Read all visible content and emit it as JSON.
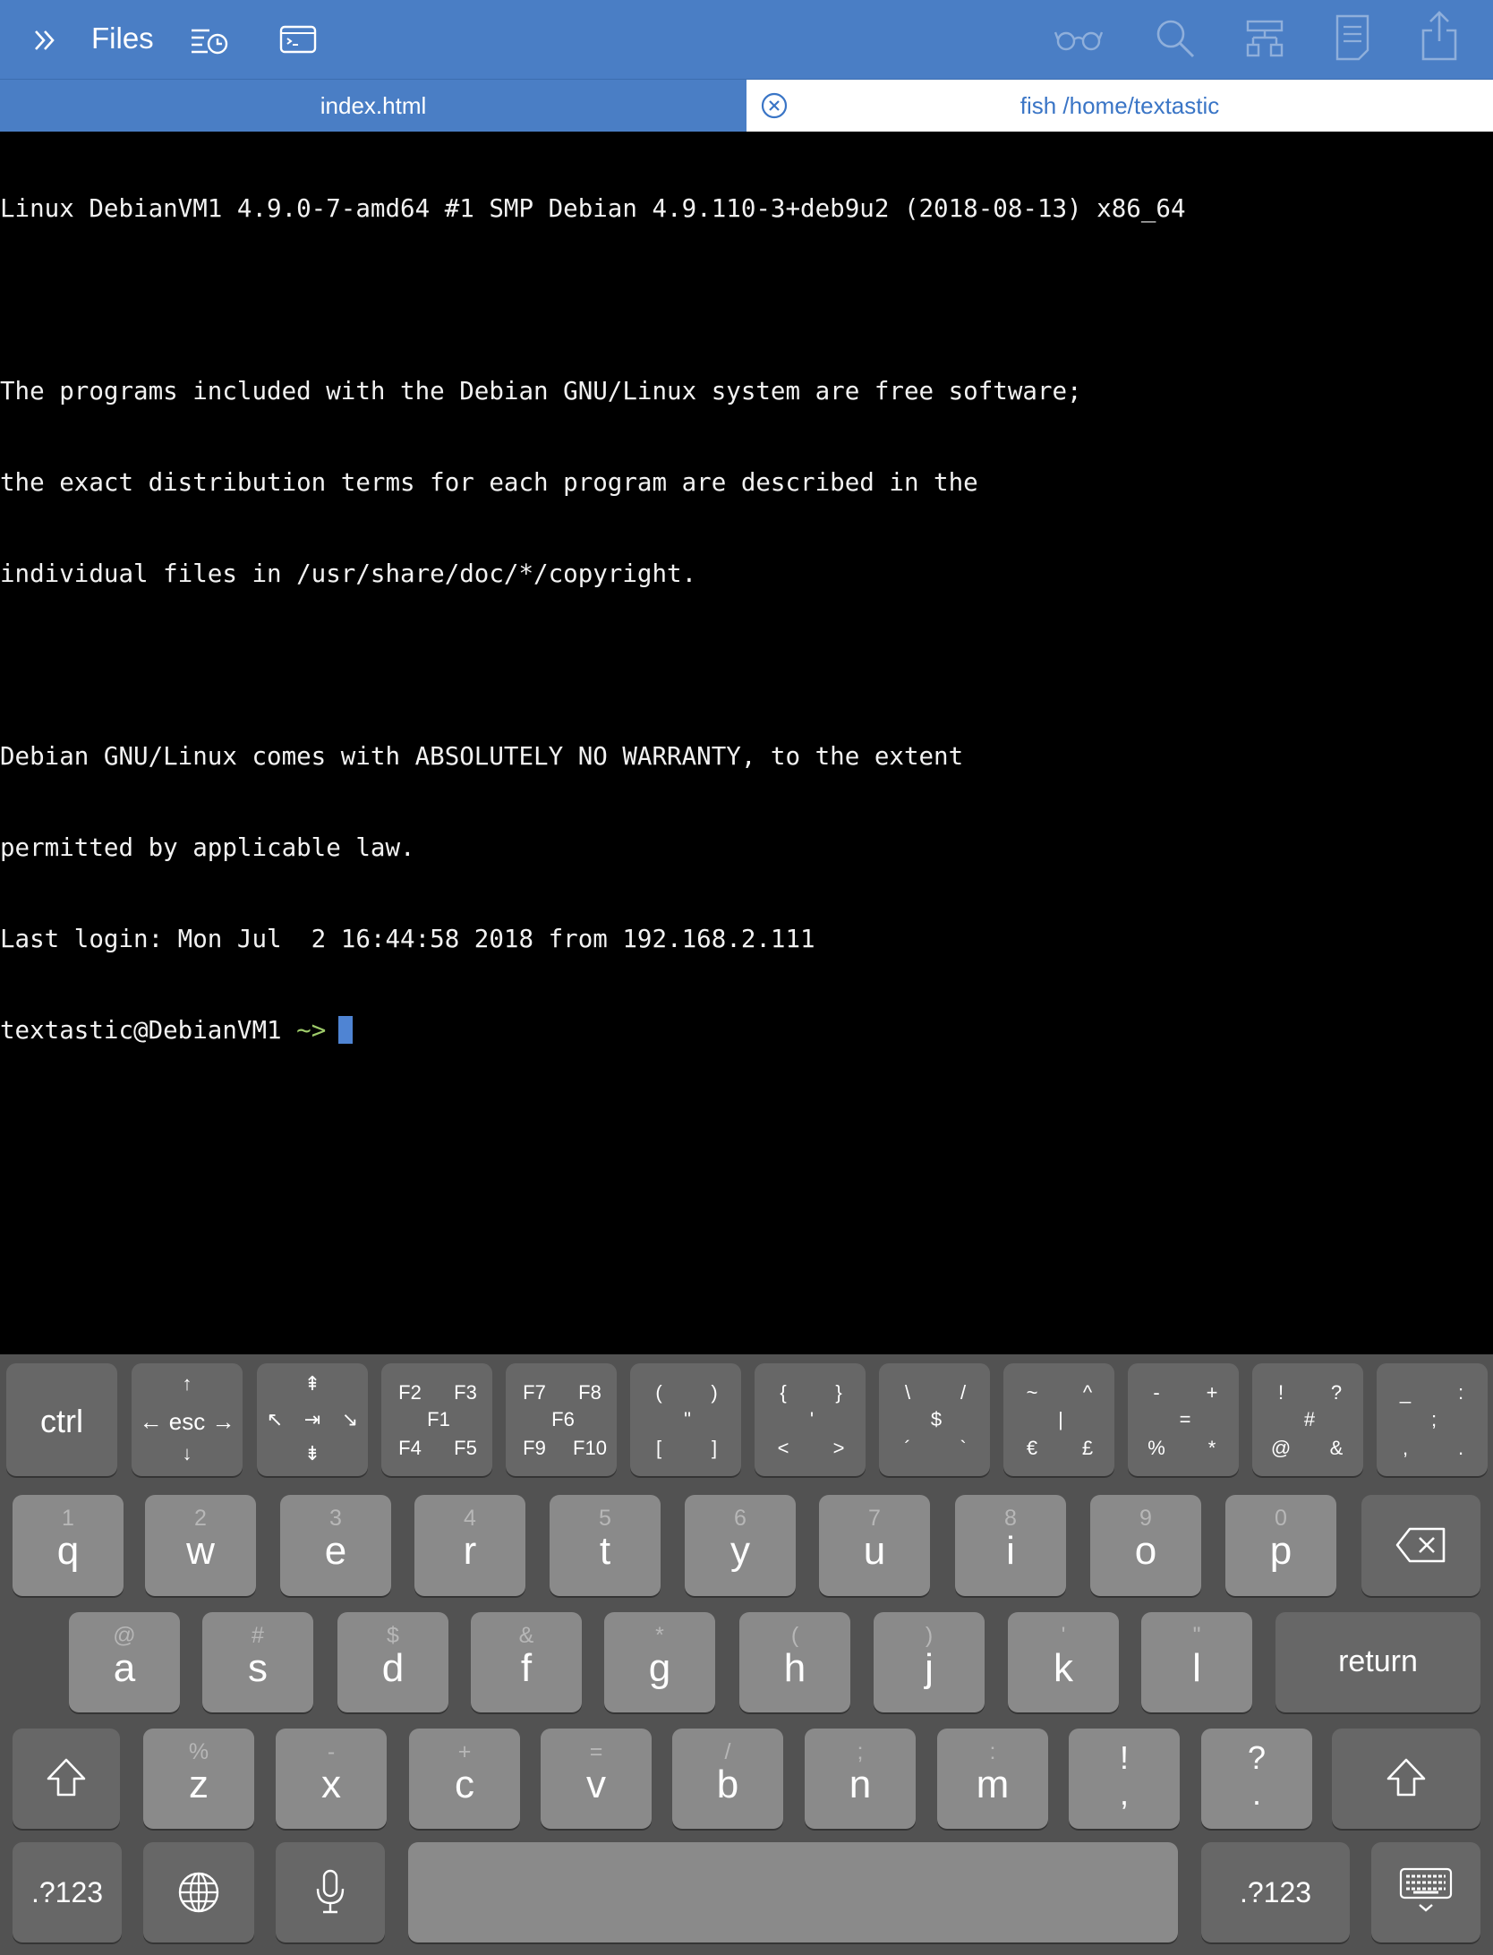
{
  "toolbar": {
    "files_label": "Files",
    "background": "#4a7ec5"
  },
  "tabs": [
    {
      "label": "index.html",
      "active": false
    },
    {
      "label": "fish  /home/textastic",
      "active": true
    }
  ],
  "terminal": {
    "lines": [
      "Linux DebianVM1 4.9.0-7-amd64 #1 SMP Debian 4.9.110-3+deb9u2 (2018-08-13) x86_64",
      "",
      "The programs included with the Debian GNU/Linux system are free software;",
      "the exact distribution terms for each program are described in the",
      "individual files in /usr/share/doc/*/copyright.",
      "",
      "Debian GNU/Linux comes with ABSOLUTELY NO WARRANTY, to the extent",
      "permitted by applicable law.",
      "Last login: Mon Jul  2 16:44:58 2018 from 192.168.2.111"
    ],
    "prompt_user": "textastic@DebianVM1",
    "prompt_symbol": "~>"
  },
  "keyboard": {
    "extra_row": {
      "ctrl": "ctrl",
      "esc": {
        "up": "↑",
        "label": "← esc →",
        "down": "↓"
      },
      "tab_key": {
        "top": "⇞",
        "left": "↖",
        "mid": "⇥",
        "right": "↘",
        "bottom": "⇟"
      },
      "fkeys_1": [
        "F2",
        "F3",
        "F1",
        "F4",
        "F5"
      ],
      "fkeys_2": [
        "F7",
        "F8",
        "F6",
        "F9",
        "F10"
      ],
      "parens": [
        "(",
        ")",
        "\"",
        "[",
        "]"
      ],
      "braces": [
        "{",
        "}",
        "'",
        "<",
        ">"
      ],
      "slashes": [
        "\\",
        "/",
        "$",
        "´",
        "`"
      ],
      "currency": [
        "~",
        "^",
        "|",
        "€",
        "£"
      ],
      "math": [
        "-",
        "+",
        "=",
        "%",
        "*"
      ],
      "punct": [
        "!",
        "?",
        "#",
        "@",
        "&"
      ],
      "misc": [
        "_",
        ":",
        ";",
        ",",
        "."
      ]
    },
    "row1": [
      {
        "key": "q",
        "alt": "1"
      },
      {
        "key": "w",
        "alt": "2"
      },
      {
        "key": "e",
        "alt": "3"
      },
      {
        "key": "r",
        "alt": "4"
      },
      {
        "key": "t",
        "alt": "5"
      },
      {
        "key": "y",
        "alt": "6"
      },
      {
        "key": "u",
        "alt": "7"
      },
      {
        "key": "i",
        "alt": "8"
      },
      {
        "key": "o",
        "alt": "9"
      },
      {
        "key": "p",
        "alt": "0"
      }
    ],
    "row2": [
      {
        "key": "a",
        "alt": "@"
      },
      {
        "key": "s",
        "alt": "#"
      },
      {
        "key": "d",
        "alt": "$"
      },
      {
        "key": "f",
        "alt": "&"
      },
      {
        "key": "g",
        "alt": "*"
      },
      {
        "key": "h",
        "alt": "("
      },
      {
        "key": "j",
        "alt": ")"
      },
      {
        "key": "k",
        "alt": "'"
      },
      {
        "key": "l",
        "alt": "\""
      }
    ],
    "return_label": "return",
    "row3": [
      {
        "key": "z",
        "alt": "%"
      },
      {
        "key": "x",
        "alt": "-"
      },
      {
        "key": "c",
        "alt": "+"
      },
      {
        "key": "v",
        "alt": "="
      },
      {
        "key": "b",
        "alt": "/"
      },
      {
        "key": "n",
        "alt": ";"
      },
      {
        "key": "m",
        "alt": ":"
      },
      {
        "key": "!",
        "alt": "!",
        "sub": ","
      },
      {
        "key": "?",
        "alt": "?",
        "sub": "."
      }
    ],
    "numbers_label": ".?123",
    "numbers_label_right": ".?123"
  }
}
